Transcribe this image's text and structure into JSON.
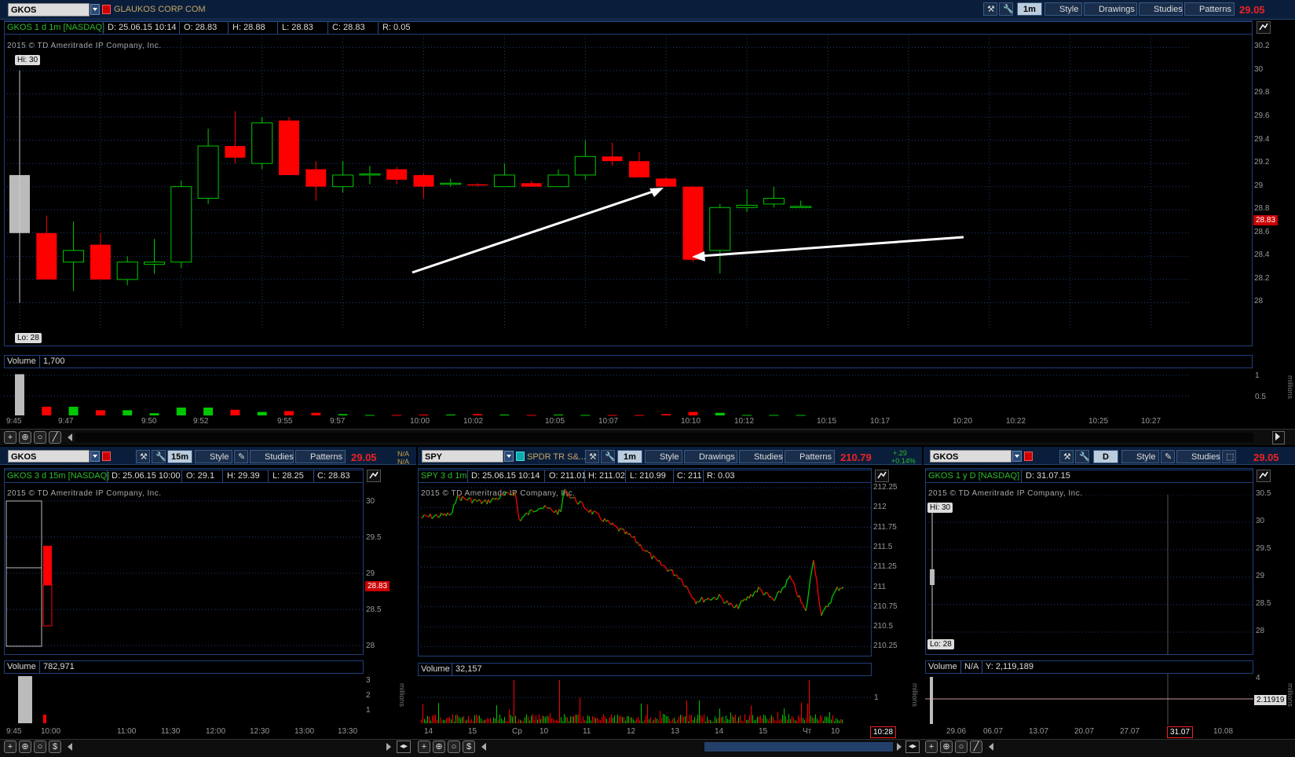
{
  "main": {
    "symbol": "GKOS",
    "company": "GLAUKOS CORP COM",
    "timeframe": "1m",
    "style_label": "Style",
    "drawings_label": "Drawings",
    "studies_label": "Studies",
    "patterns_label": "Patterns",
    "last_price": "29.05",
    "info": {
      "title": "GKOS 1 d 1m [NASDAQ]",
      "date": "D: 25.06.15 10:14",
      "open": "O: 28.83",
      "high": "H: 28.88",
      "low": "L: 28.83",
      "close": "C: 28.83",
      "range": "R: 0.05"
    },
    "copyright": "2015 © TD Ameritrade IP Company, Inc.",
    "hi_label": "Hi: 30",
    "lo_label": "Lo: 28",
    "current_price_badge": "28.83",
    "y_ticks": [
      "30.2",
      "30",
      "29.8",
      "29.6",
      "29.4",
      "29.2",
      "29",
      "28.8",
      "28.6",
      "28.4",
      "28.2",
      "28"
    ],
    "x_ticks": [
      "9:45",
      "9:47",
      "9:50",
      "9:52",
      "9:55",
      "9:57",
      "10:00",
      "10:02",
      "10:05",
      "10:07",
      "10:10",
      "10:12",
      "10:15",
      "10:17",
      "10:20",
      "10:22",
      "10:25",
      "10:27"
    ],
    "volume_label": "Volume",
    "volume_value": "1,700",
    "volume_ticks": [
      "1",
      "0.5"
    ],
    "volume_units": "millions",
    "chart_data": {
      "type": "candlestick",
      "ylim": [
        27.8,
        30.25
      ],
      "candles": [
        {
          "t": "9:45",
          "o": 29.1,
          "h": 30.0,
          "l": 28.0,
          "c": 28.6
        },
        {
          "t": "9:46",
          "o": 28.6,
          "h": 28.75,
          "l": 28.2,
          "c": 28.2
        },
        {
          "t": "9:47",
          "o": 28.35,
          "h": 28.7,
          "l": 28.1,
          "c": 28.45
        },
        {
          "t": "9:48",
          "o": 28.5,
          "h": 28.6,
          "l": 28.2,
          "c": 28.2
        },
        {
          "t": "9:49",
          "o": 28.2,
          "h": 28.4,
          "l": 28.15,
          "c": 28.35
        },
        {
          "t": "9:50",
          "o": 28.33,
          "h": 28.55,
          "l": 28.25,
          "c": 28.35
        },
        {
          "t": "9:51",
          "o": 28.35,
          "h": 29.05,
          "l": 28.3,
          "c": 29.0
        },
        {
          "t": "9:52",
          "o": 28.9,
          "h": 29.5,
          "l": 28.85,
          "c": 29.35
        },
        {
          "t": "9:53",
          "o": 29.35,
          "h": 29.65,
          "l": 29.2,
          "c": 29.25
        },
        {
          "t": "9:54",
          "o": 29.2,
          "h": 29.6,
          "l": 29.15,
          "c": 29.55
        },
        {
          "t": "9:55",
          "o": 29.57,
          "h": 29.6,
          "l": 29.1,
          "c": 29.1
        },
        {
          "t": "9:56",
          "o": 29.15,
          "h": 29.22,
          "l": 28.88,
          "c": 29.0
        },
        {
          "t": "9:57",
          "o": 29.0,
          "h": 29.22,
          "l": 28.95,
          "c": 29.1
        },
        {
          "t": "9:58",
          "o": 29.1,
          "h": 29.18,
          "l": 29.02,
          "c": 29.11
        },
        {
          "t": "9:59",
          "o": 29.15,
          "h": 29.17,
          "l": 29.02,
          "c": 29.06
        },
        {
          "t": "10:00",
          "o": 29.1,
          "h": 29.12,
          "l": 28.9,
          "c": 29.0
        },
        {
          "t": "10:01",
          "o": 29.02,
          "h": 29.07,
          "l": 29.0,
          "c": 29.03
        },
        {
          "t": "10:02",
          "o": 29.02,
          "h": 29.03,
          "l": 29.0,
          "c": 29.01
        },
        {
          "t": "10:03",
          "o": 29.0,
          "h": 29.2,
          "l": 29.0,
          "c": 29.1
        },
        {
          "t": "10:04",
          "o": 29.03,
          "h": 29.05,
          "l": 29.0,
          "c": 29.0
        },
        {
          "t": "10:05",
          "o": 29.0,
          "h": 29.15,
          "l": 29.0,
          "c": 29.1
        },
        {
          "t": "10:06",
          "o": 29.1,
          "h": 29.4,
          "l": 29.06,
          "c": 29.26
        },
        {
          "t": "10:07",
          "o": 29.26,
          "h": 29.38,
          "l": 29.18,
          "c": 29.22
        },
        {
          "t": "10:08",
          "o": 29.22,
          "h": 29.3,
          "l": 29.08,
          "c": 29.08
        },
        {
          "t": "10:09",
          "o": 29.07,
          "h": 29.08,
          "l": 29.0,
          "c": 29.0
        },
        {
          "t": "10:10",
          "o": 29.0,
          "h": 29.0,
          "l": 28.35,
          "c": 28.37
        },
        {
          "t": "10:11",
          "o": 28.45,
          "h": 28.85,
          "l": 28.25,
          "c": 28.82
        },
        {
          "t": "10:12",
          "o": 28.82,
          "h": 28.98,
          "l": 28.78,
          "c": 28.84
        },
        {
          "t": "10:13",
          "o": 28.85,
          "h": 29.0,
          "l": 28.82,
          "c": 28.9
        },
        {
          "t": "10:14",
          "o": 28.83,
          "h": 28.88,
          "l": 28.83,
          "c": 28.83
        }
      ],
      "volume": [
        0.95,
        0.2,
        0.2,
        0.12,
        0.12,
        0.05,
        0.18,
        0.18,
        0.13,
        0.08,
        0.1,
        0.06,
        0.03,
        0.01,
        0.01,
        0.02,
        0.02,
        0.03,
        0.02,
        0.01,
        0.02,
        0.01,
        0.01,
        0.01,
        0.03,
        0.08,
        0.06,
        0.01,
        0.01,
        0.01
      ]
    }
  },
  "panel1": {
    "symbol": "GKOS",
    "timeframe": "15m",
    "style_label": "Style",
    "studies_label": "Studies",
    "patterns_label": "Patterns",
    "last_price": "29.05",
    "na1": "N/A",
    "na2": "N/A",
    "info": {
      "title": "GKOS 3 d 15m [NASDAQ]",
      "date": "D: 25.06.15 10:00",
      "open": "O: 29.1",
      "high": "H: 29.39",
      "low": "L: 28.25",
      "close": "C: 28.83"
    },
    "copyright": "2015 © TD Ameritrade IP Company, Inc.",
    "price_badge": "28.83",
    "y_ticks": [
      "30",
      "29.5",
      "29",
      "28.5",
      "28"
    ],
    "x_ticks": [
      "9:45",
      "10:00",
      "11:00",
      "11:30",
      "12:00",
      "12:30",
      "13:00",
      "13:30"
    ],
    "volume_label": "Volume",
    "volume_value": "782,971",
    "volume_ticks": [
      "3",
      "2",
      "1"
    ],
    "volume_units": "millions"
  },
  "panel2": {
    "symbol": "SPY",
    "company": "SPDR TR S&...",
    "timeframe": "1m",
    "style_label": "Style",
    "drawings_label": "Drawings",
    "studies_label": "Studies",
    "patterns_label": "Patterns",
    "last_price": "210.79",
    "change": "+.29",
    "change_pct": "+0.14%",
    "info": {
      "title": "SPY 3 d 1m",
      "date": "D: 25.06.15 10:14",
      "open": "O: 211.01",
      "high": "H: 211.02",
      "low": "L: 210.99",
      "close": "C: 211",
      "range": "R: 0.03"
    },
    "copyright": "2015 © TD Ameritrade IP Company, Inc.",
    "y_ticks": [
      "212.25",
      "212",
      "211.75",
      "211.5",
      "211.25",
      "211",
      "210.75",
      "210.5",
      "210.25"
    ],
    "x_ticks": [
      "14",
      "15",
      "Ср",
      "10",
      "11",
      "12",
      "13",
      "14",
      "15",
      "Чт",
      "10"
    ],
    "time_badge": "10:28",
    "volume_label": "Volume",
    "volume_value": "32,157",
    "volume_ticks": [
      "1"
    ],
    "volume_units": "millions"
  },
  "panel3": {
    "symbol": "GKOS",
    "timeframe": "D",
    "style_label": "Style",
    "studies_label": "Studies",
    "last_price": "29.05",
    "info": {
      "title": "GKOS 1 y D [NASDAQ]",
      "date": "D: 31.07.15"
    },
    "copyright": "2015 © TD Ameritrade IP Company, Inc.",
    "hi_label": "Hi: 30",
    "lo_label": "Lo: 28",
    "y_ticks": [
      "30.5",
      "30",
      "29.5",
      "29",
      "28.5",
      "28"
    ],
    "x_ticks": [
      "29.06",
      "06.07",
      "13.07",
      "20.07",
      "27.07",
      "10.08"
    ],
    "date_badge": "31.07",
    "volume_label": "Volume",
    "volume_na": "N/A",
    "volume_y": "Y: 2,119,189",
    "volume_ticks": [
      "4"
    ],
    "volume_badge": "2.11919",
    "volume_units": "millions"
  },
  "colors": {
    "up": "#00c800",
    "down": "#ff0000",
    "grid": "#1e3c78",
    "frame": "#1f3f7a",
    "accent_price": "#ee2222"
  }
}
